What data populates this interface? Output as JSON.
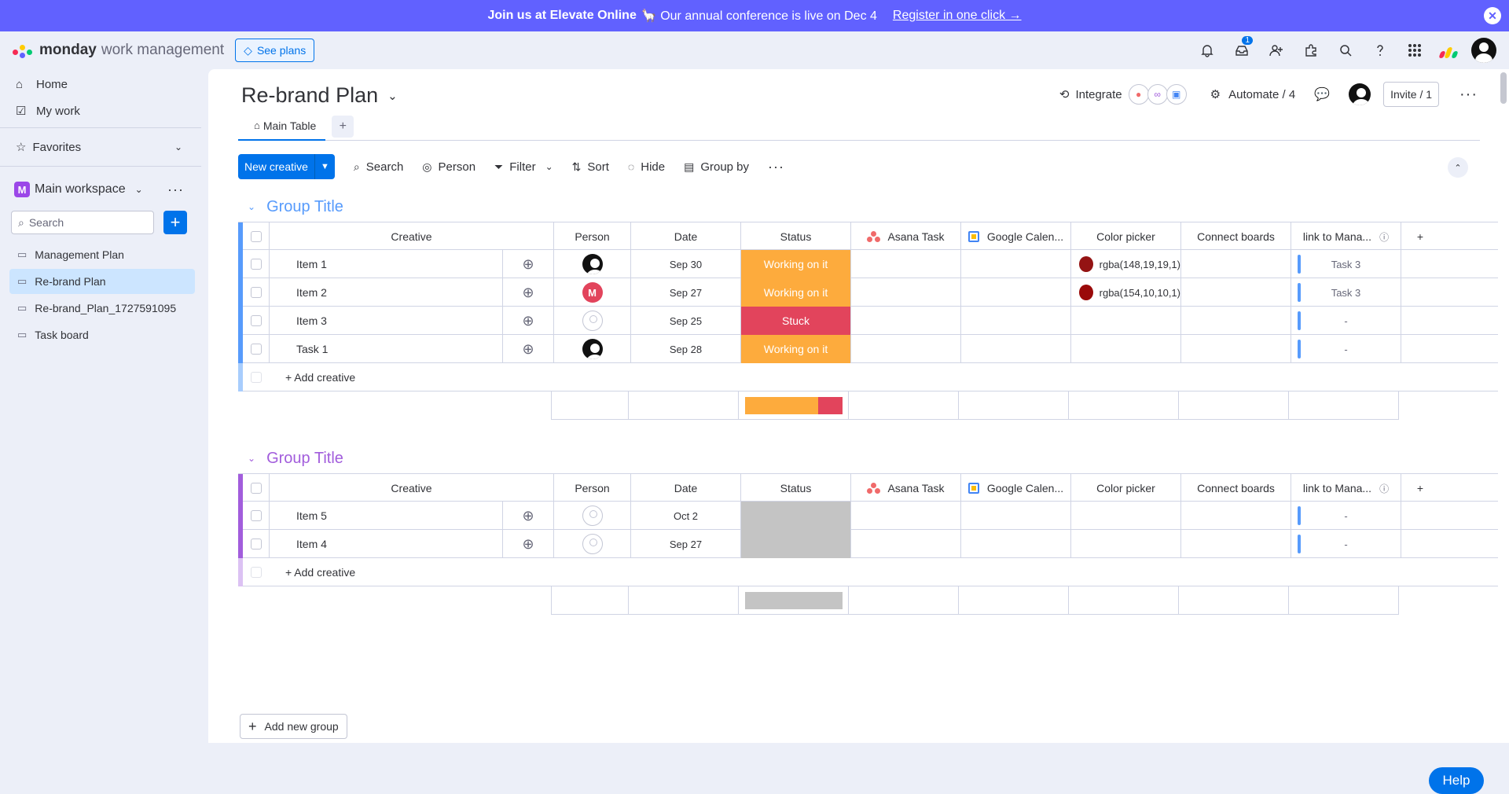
{
  "banner": {
    "bold": "Join us at Elevate Online",
    "text": "🦙 Our annual conference is live on Dec 4",
    "link": "Register in one click →",
    "close": "✕"
  },
  "topbar": {
    "brand": "monday",
    "product": "work management",
    "see_plans": "See plans",
    "inbox_badge": "1",
    "colors": {
      "brand": "#6161ff",
      "accent": "#0073ea"
    }
  },
  "sidebar": {
    "home": "Home",
    "my_work": "My work",
    "favorites": "Favorites",
    "workspace_letter": "M",
    "workspace": "Main workspace",
    "search_placeholder": "Search",
    "boards": [
      {
        "label": "Management Plan"
      },
      {
        "label": "Re-brand Plan"
      },
      {
        "label": "Re-brand_Plan_1727591095"
      },
      {
        "label": "Task board"
      }
    ]
  },
  "board": {
    "title": "Re-brand Plan",
    "integrate": "Integrate",
    "automate": "Automate / 4",
    "invite": "Invite / 1",
    "tab": "Main Table",
    "tab_add": "+"
  },
  "toolbar": {
    "new_item": "New creative",
    "search": "Search",
    "person": "Person",
    "filter": "Filter",
    "sort": "Sort",
    "hide": "Hide",
    "group_by": "Group by"
  },
  "columns": {
    "name": "Creative",
    "person": "Person",
    "date": "Date",
    "status": "Status",
    "asana": "Asana Task",
    "gcal": "Google Calen...",
    "color": "Color picker",
    "connect": "Connect boards",
    "link": "link to Mana...",
    "add": "+"
  },
  "groups": [
    {
      "title": "Group Title",
      "color": "#579bfc",
      "add_item": "+ Add creative",
      "rows": [
        {
          "name": "Item 1",
          "person": "dark",
          "date": "Sep 30",
          "status": "Working on it",
          "status_color": "#fdab3d",
          "color_value": "rgba(148,19,19,1)",
          "color_swatch": "#941313",
          "link": "Task 3"
        },
        {
          "name": "Item 2",
          "person": "M",
          "date": "Sep 27",
          "status": "Working on it",
          "status_color": "#fdab3d",
          "color_value": "rgba(154,10,10,1)",
          "color_swatch": "#9a0a0a",
          "link": "Task 3"
        },
        {
          "name": "Item 3",
          "person": "empty",
          "date": "Sep 25",
          "status": "Stuck",
          "status_color": "#e2445c",
          "color_value": "",
          "color_swatch": "",
          "link": "-"
        },
        {
          "name": "Task 1",
          "person": "dark",
          "date": "Sep 28",
          "status": "Working on it",
          "status_color": "#fdab3d",
          "color_value": "",
          "color_swatch": "",
          "link": "-"
        }
      ],
      "summary": [
        {
          "color": "#fdab3d",
          "fraction": 0.75
        },
        {
          "color": "#e2445c",
          "fraction": 0.25
        }
      ]
    },
    {
      "title": "Group Title",
      "color": "#a25ddc",
      "add_item": "+ Add creative",
      "rows": [
        {
          "name": "Item 5",
          "person": "empty",
          "date": "Oct 2",
          "status": "",
          "status_color": "#c4c4c4",
          "color_value": "",
          "color_swatch": "",
          "link": "-"
        },
        {
          "name": "Item 4",
          "person": "empty",
          "date": "Sep 27",
          "status": "",
          "status_color": "#c4c4c4",
          "color_value": "",
          "color_swatch": "",
          "link": "-"
        }
      ],
      "summary": [
        {
          "color": "#c4c4c4",
          "fraction": 1
        }
      ]
    }
  ],
  "add_group": "Add new group",
  "help": "Help"
}
